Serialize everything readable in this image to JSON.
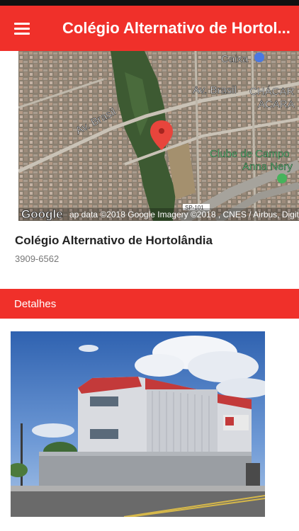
{
  "app_bar": {
    "title": "Colégio Alternativo de Hortol...",
    "menu_icon": "menu-icon"
  },
  "map": {
    "labels": {
      "caixa": "Caixa",
      "av_brasil_1": "Av. Brasil",
      "av_brasil_2": "Av. Brasil",
      "chacara_1": "CHÁCAR",
      "chacara_2": "ACARA",
      "clube_1": "Clube de Campo",
      "clube_2": "Anna Nery",
      "road": "SP-101"
    },
    "google_logo": "Google",
    "attribution": "ap data ©2018 Google  Imagery ©2018 , CNES / Airbus, DigitalGlobe"
  },
  "place": {
    "name": "Colégio Alternativo de Hortolândia",
    "phone": "3909-6562"
  },
  "details": {
    "label": "Detalhes"
  },
  "colors": {
    "brand_red": "#f0302a"
  }
}
